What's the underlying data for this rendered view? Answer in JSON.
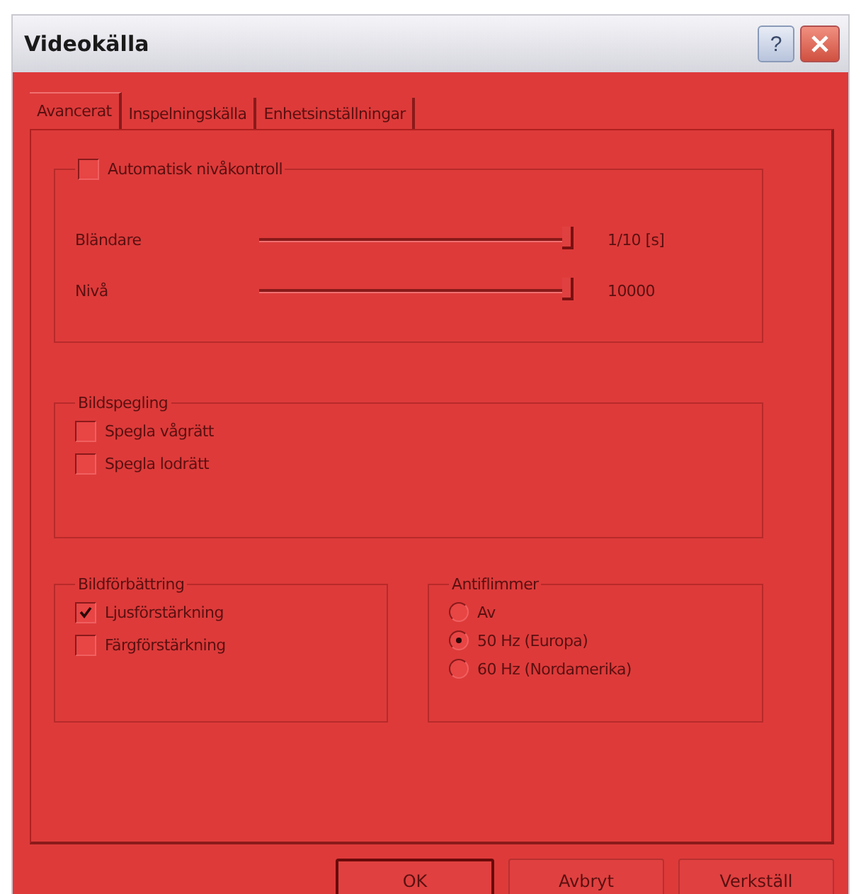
{
  "window": {
    "title": "Videokälla",
    "help_button": "?"
  },
  "tabs": [
    {
      "label": "Avancerat",
      "selected": true
    },
    {
      "label": "Inspelningskälla",
      "selected": false
    },
    {
      "label": "Enhetsinställningar",
      "selected": false
    }
  ],
  "auto_level": {
    "label": "Automatisk nivåkontroll",
    "checked": false
  },
  "sliders": [
    {
      "label": "Bländare",
      "level": 1,
      "reading": "1/10 [s]"
    },
    {
      "label": "Nivå",
      "level": 1,
      "reading": "10000"
    }
  ],
  "mirroring": {
    "title": "Bildspegling",
    "options": [
      {
        "label": "Spegla vågrätt",
        "checked": false
      },
      {
        "label": "Spegla lodrätt",
        "checked": false
      }
    ]
  },
  "enhancement": {
    "title": "Bildförbättring",
    "options": [
      {
        "label": "Ljusförstärkning",
        "checked": true
      },
      {
        "label": "Färgförstärkning",
        "checked": false
      }
    ]
  },
  "antiflicker": {
    "title": "Antiflimmer",
    "options": [
      {
        "label": "Av",
        "selected": false
      },
      {
        "label": "50 Hz (Europa)",
        "selected": true
      },
      {
        "label": "60 Hz (Nordamerika)",
        "selected": false
      }
    ]
  },
  "buttons": [
    {
      "label": "OK",
      "default": true
    },
    {
      "label": "Avbryt",
      "default": false
    },
    {
      "label": "Verkställ",
      "default": false
    }
  ]
}
